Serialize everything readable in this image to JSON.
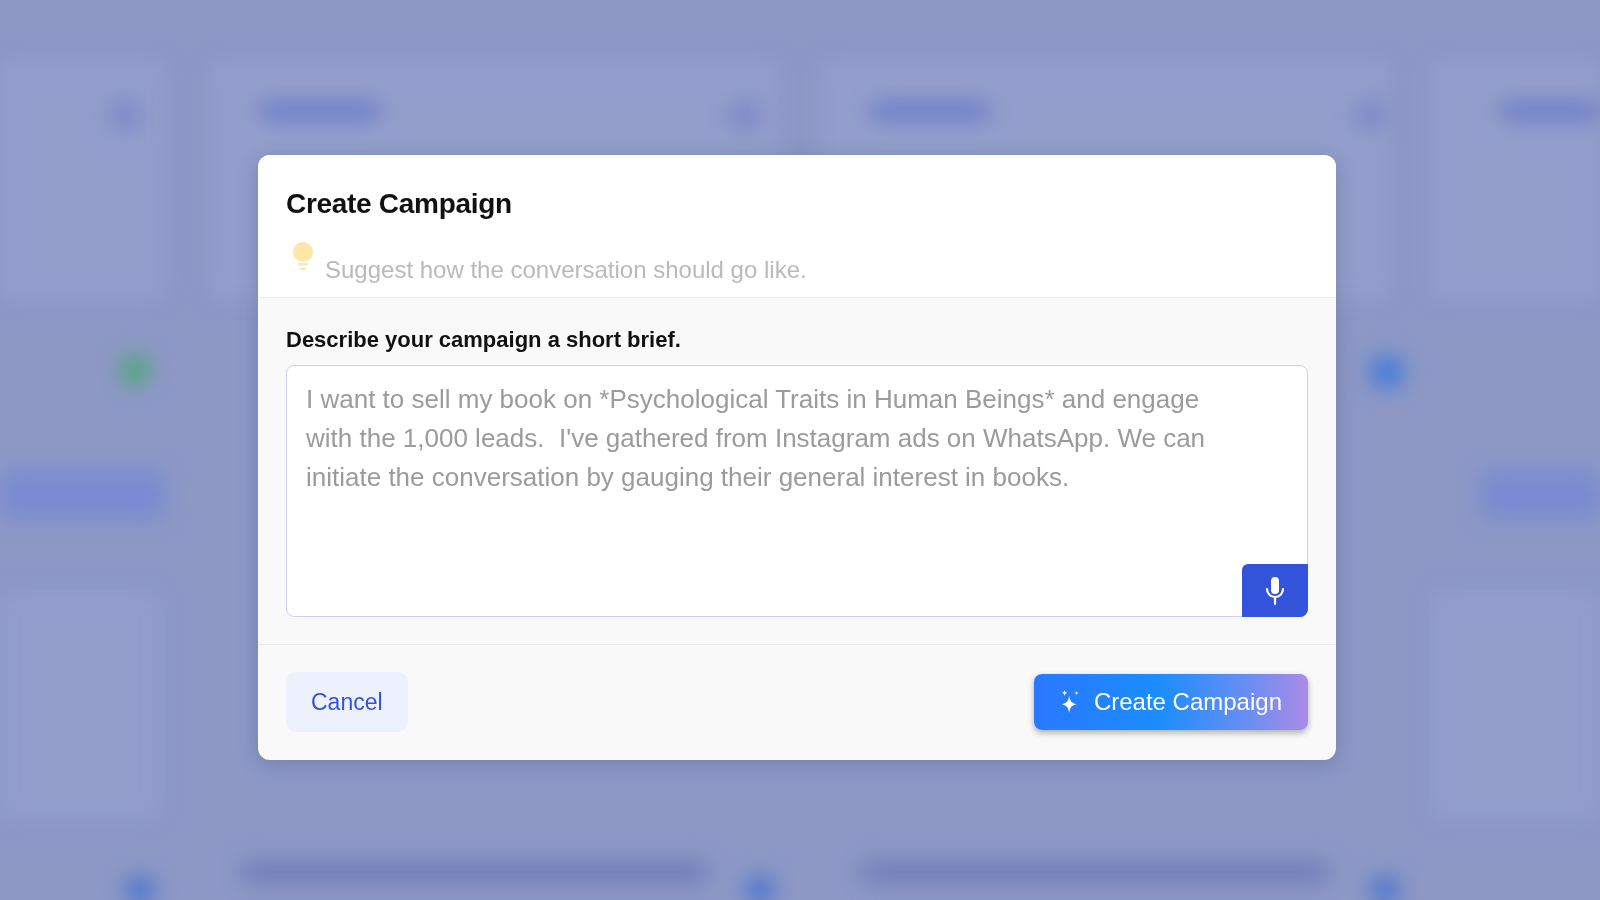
{
  "dialog": {
    "title": "Create Campaign",
    "hint": "Suggest how the conversation should go like.",
    "brief": {
      "label": "Describe your campaign a short brief.",
      "placeholder": "I want to sell my book on *Psychological Traits in Human Beings* and engage with the 1,000 leads.  I've gathered from Instagram ads on WhatsApp. We can initiate the conversation by gauging their general interest in books."
    },
    "buttons": [
      {
        "kind": "secondary",
        "label": "Cancel"
      },
      {
        "kind": "primary",
        "label": "Create Campaign"
      }
    ]
  }
}
